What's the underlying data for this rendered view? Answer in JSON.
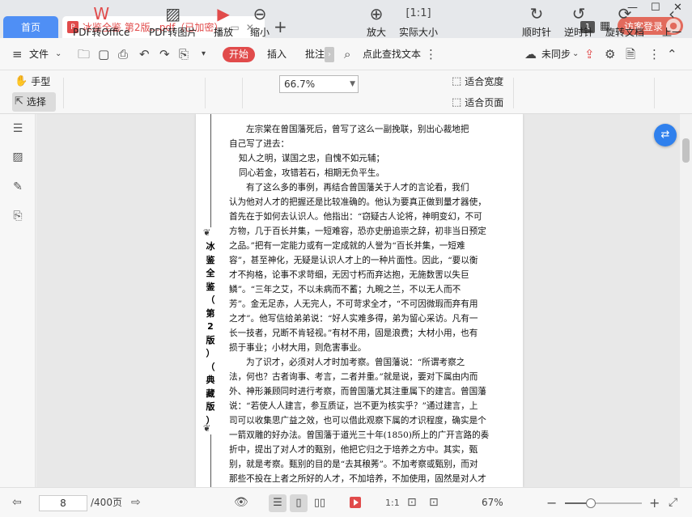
{
  "tabs": {
    "home": "首页",
    "doc_title": "冰鉴全鉴 第2版...pdf（已加密）",
    "add": "+"
  },
  "window": {
    "badge": "1",
    "login": "访客登录"
  },
  "menubar": {
    "file": "文件",
    "start": "开始",
    "insert": "插入",
    "annotate": "批注",
    "search": "点此查找文本",
    "sync": "未同步"
  },
  "ribbon": {
    "hand": "手型",
    "select": "选择",
    "pdf_to_office": "PDF转Office",
    "pdf_to_image": "PDF转图片",
    "play": "播放",
    "zoom_out": "缩小",
    "zoom_value": "66.7%",
    "zoom_in": "放大",
    "actual_size": "实际大小",
    "fit_width": "适合宽度",
    "fit_page": "适合页面",
    "rotate_cw": "顺时针",
    "rotate_ccw": "逆时针",
    "rotate_doc": "旋转文档",
    "prev": "上一"
  },
  "page": {
    "side_title": [
      "冰",
      "鉴",
      "全",
      "鉴",
      "（",
      "第",
      "2",
      "版",
      "）",
      "（",
      "典",
      "藏",
      "版",
      "）"
    ],
    "lines": [
      {
        "cls": "ind",
        "text": "左宗棠在曾国藩死后，曾写了这么一副挽联，别出心裁地把"
      },
      {
        "cls": "",
        "text": "自己写了进去："
      },
      {
        "cls": "ind2",
        "text": "知人之明，谋国之忠，自愧不如元辅；"
      },
      {
        "cls": "ind2",
        "text": "同心若金，攻错若石，相期无负平生。"
      },
      {
        "cls": "ind",
        "text": "有了这么多的事例，再结合曾国藩关于人才的言论看，我们"
      },
      {
        "cls": "",
        "text": "认为他对人才的把握还是比较准确的。他认为要真正做到量才器使，"
      },
      {
        "cls": "",
        "text": "首先在于如何去认识人。他指出：“窃疑古人论将，神明变幻，不可"
      },
      {
        "cls": "",
        "text": "方物，几于百长并集，一短难容，恐亦史册追崇之辞，初非当日预定"
      },
      {
        "cls": "",
        "text": "之品。”把有一定能力或有一定成就的人誉为“百长并集，一短难"
      },
      {
        "cls": "",
        "text": "容”，甚至神化，无疑是认识人才上的一种片面性。因此，“要以衡"
      },
      {
        "cls": "",
        "text": "才不拘格，论事不求苛细，无因寸朽而弃达抱，无施数罟以失巨"
      },
      {
        "cls": "",
        "text": "鳞”。“三年之艾，不以未病而不蓄；九畹之兰，不以无人而不"
      },
      {
        "cls": "",
        "text": "芳”。金无足赤，人无完人，不可苛求全才，“不可因微瑕而弃有用"
      },
      {
        "cls": "",
        "text": "之才”。他写信给弟弟说：“好人实难多得，弟为留心采访。凡有一"
      },
      {
        "cls": "",
        "text": "长一技者，兄断不肯轻视。”有材不用，固是浪费；大材小用，也有"
      },
      {
        "cls": "",
        "text": "损于事业；小材大用，则危害事业。"
      },
      {
        "cls": "ind",
        "text": "为了识才，必须对人才时加考察。曾国藩说：“所谓考察之"
      },
      {
        "cls": "",
        "text": "法，何也？古者询事、考言，二者并重。”就是说，要对下属由内而"
      },
      {
        "cls": "",
        "text": "外、神形兼顾同时进行考察，而曾国藩尤其注重属下的建言。曾国藩"
      },
      {
        "cls": "",
        "text": "说：“若使人人建言，参互质证，岂不更为核实乎？”通过建言，上"
      },
      {
        "cls": "",
        "text": "司可以收集思广益之效，也可以借此观察下属的才识程度，确实是个"
      },
      {
        "cls": "",
        "text": "一箭双雕的好办法。曾国藩于道光三十年(1850)所上的广开言路的奏"
      },
      {
        "cls": "",
        "text": "折中，提出了对人才的甄别，他把它归之于培养之方中。其实，甄"
      },
      {
        "cls": "",
        "text": "别，就是考察。甄别的目的是“去其稂莠”。不加考察或甄别，而对"
      },
      {
        "cls": "",
        "text": "那些不投在上者之所好的人才，不加培养，不加使用，固然是对人才"
      }
    ]
  },
  "status": {
    "current_page": "8",
    "total_pages": "/400页",
    "zoom_pct": "67%",
    "zoom_fraction": 0.34
  }
}
